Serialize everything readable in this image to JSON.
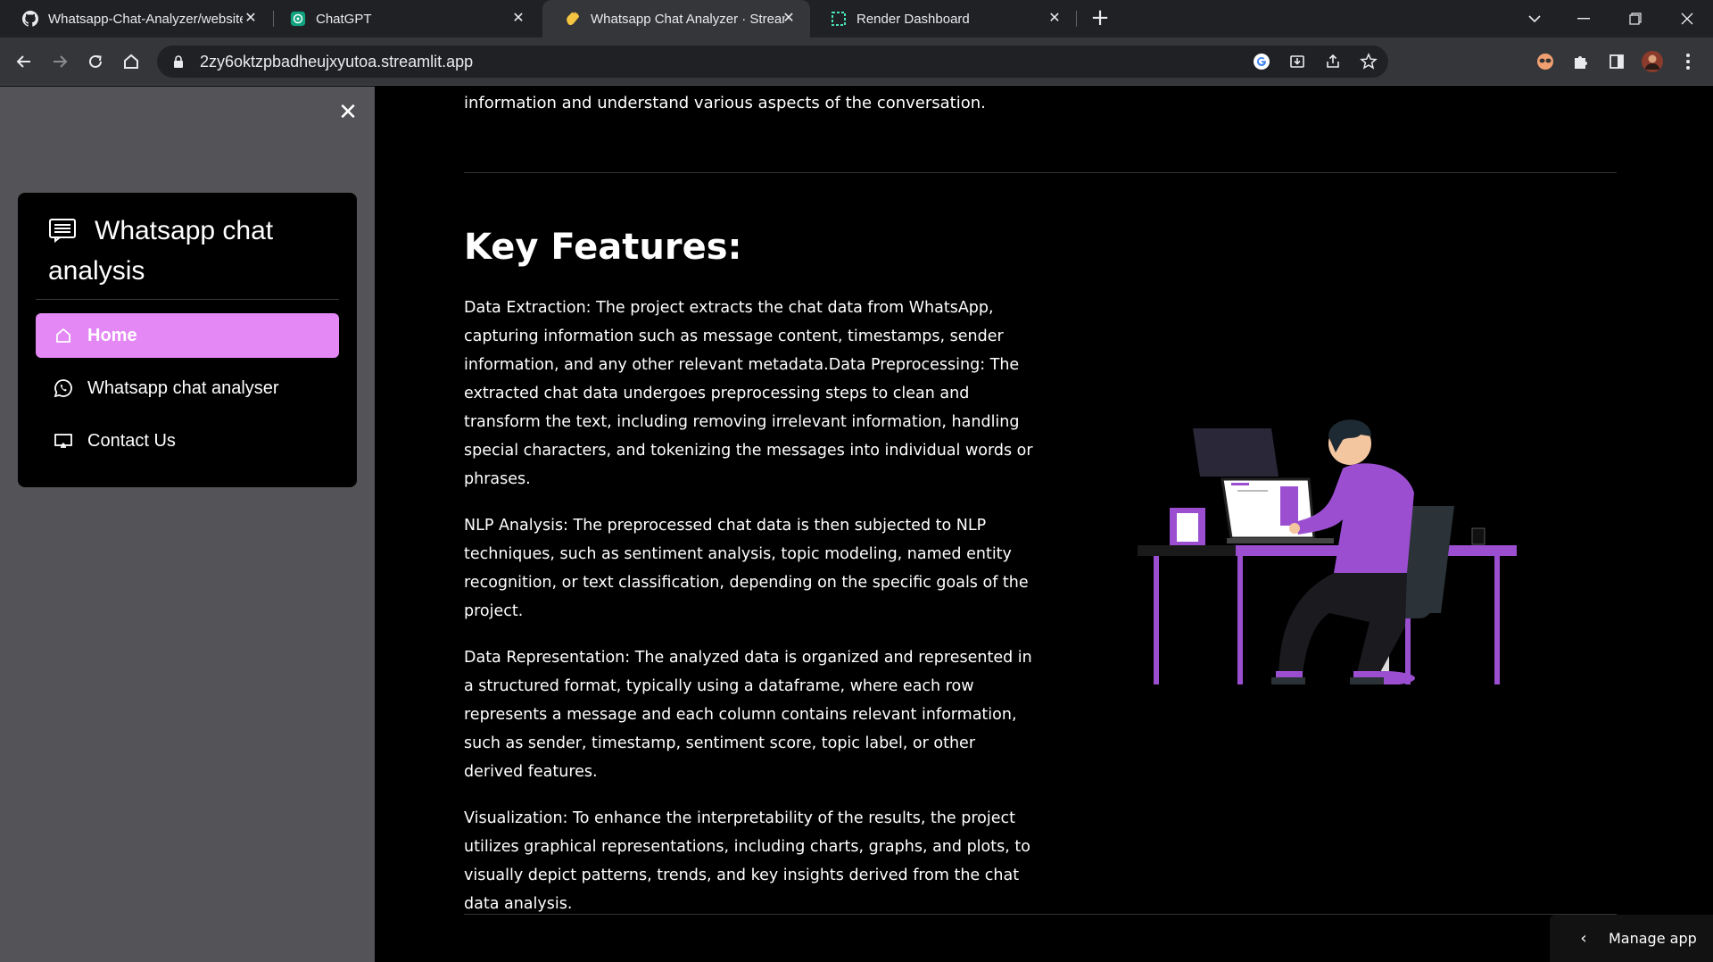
{
  "browser": {
    "tabs": [
      {
        "title": "Whatsapp-Chat-Analyzer/website",
        "icon": "github-icon",
        "active": false
      },
      {
        "title": "ChatGPT",
        "icon": "chatgpt-icon",
        "active": false
      },
      {
        "title": "Whatsapp Chat Analyzer · Stream",
        "icon": "waving-hand-icon",
        "active": true
      },
      {
        "title": "Render Dashboard",
        "icon": "render-icon",
        "active": false
      }
    ],
    "url": "2zy6oktzpbadheujxyutoa.streamlit.app"
  },
  "sidebar": {
    "close_symbol": "✕",
    "header": "Whatsapp chat analysis",
    "header_icon": "chat-list-icon",
    "items": [
      {
        "label": "Home",
        "icon": "house-icon",
        "active": true
      },
      {
        "label": "Whatsapp chat analyser",
        "icon": "whatsapp-icon",
        "active": false
      },
      {
        "label": "Contact Us",
        "icon": "monitor-icon",
        "active": false
      }
    ],
    "active_color": "#e388f5"
  },
  "main": {
    "intro_tail": "information and understand various aspects of the conversation.",
    "heading": "Key Features:",
    "paragraphs": [
      "Data Extraction: The project extracts the chat data from WhatsApp, capturing information such as message content, timestamps, sender information, and any other relevant metadata.Data Preprocessing: The extracted chat data undergoes preprocessing steps to clean and transform the text, including removing irrelevant information, handling special characters, and tokenizing the messages into individual words or phrases.",
      "NLP Analysis: The preprocessed chat data is then subjected to NLP techniques, such as sentiment analysis, topic modeling, named entity recognition, or text classification, depending on the specific goals of the project.",
      "Data Representation: The analyzed data is organized and represented in a structured format, typically using a dataframe, where each row represents a message and each column contains relevant information, such as sender, timestamp, sentiment score, topic label, or other derived features.",
      "Visualization: To enhance the interpretability of the results, the project utilizes graphical representations, including charts, graphs, and plots, to visually depict patterns, trends, and key insights derived from the chat data analysis."
    ],
    "illustration_accent": "#9b4fd0"
  },
  "manage_app": {
    "label": "Manage app",
    "chevron": "‹"
  }
}
